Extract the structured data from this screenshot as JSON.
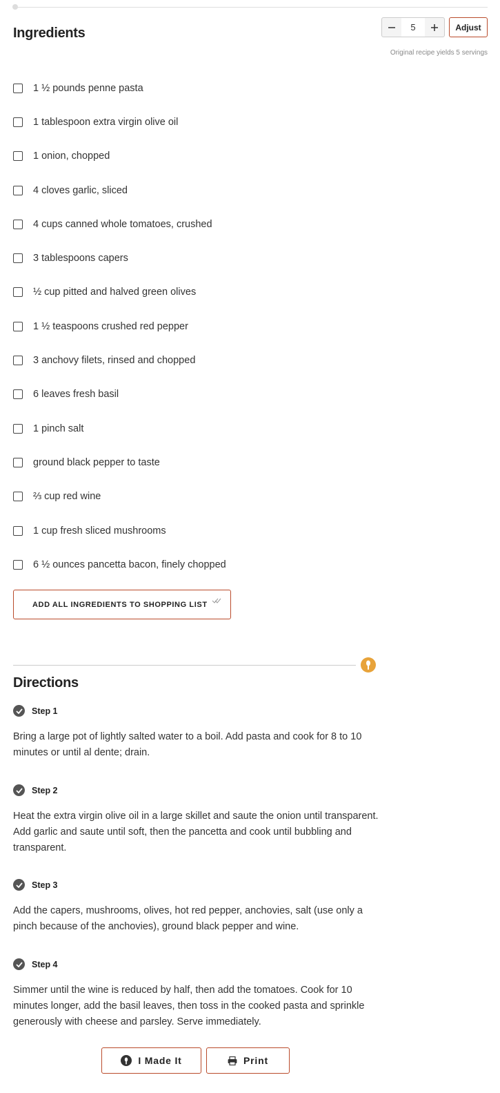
{
  "ingredients": {
    "title": "Ingredients",
    "servings": {
      "value": "5",
      "minus_icon": "minus-icon",
      "plus_icon": "plus-icon",
      "adjust_label": "Adjust",
      "note": "Original recipe yields 5 servings"
    },
    "items": [
      "1 ½ pounds penne pasta",
      "1 tablespoon extra virgin olive oil",
      "1 onion, chopped",
      "4 cloves garlic, sliced",
      "4 cups canned whole tomatoes, crushed",
      "3 tablespoons capers",
      "½ cup pitted and halved green olives",
      "1 ½ teaspoons crushed red pepper",
      "3 anchovy filets, rinsed and chopped",
      "6 leaves fresh basil",
      "1 pinch salt",
      "ground black pepper to taste",
      "⅔ cup red wine",
      "1 cup fresh sliced mushrooms",
      "6 ½ ounces pancetta bacon, finely chopped"
    ],
    "shopping_button": "ADD ALL INGREDIENTS TO SHOPPING LIST"
  },
  "directions": {
    "title": "Directions",
    "steps": [
      {
        "label": "Step 1",
        "text": "Bring a large pot of lightly salted water to a boil. Add pasta and cook for 8 to 10 minutes or until al dente; drain."
      },
      {
        "label": "Step 2",
        "text": "Heat the extra virgin olive oil in a large skillet and saute the onion until transparent. Add garlic and saute until soft, then the pancetta and cook until bubbling and transparent."
      },
      {
        "label": "Step 3",
        "text": "Add the capers, mushrooms, olives, hot red pepper, anchovies, salt (use only a pinch because of the anchovies), ground black pepper and wine."
      },
      {
        "label": "Step 4",
        "text": "Simmer until the wine is reduced by half, then add the tomatoes. Cook for 10 minutes longer, add the basil leaves, then toss in the cooked pasta and sprinkle generously with cheese and parsley. Serve immediately."
      }
    ]
  },
  "actions": {
    "made_it": "I Made It",
    "print": "Print"
  },
  "colors": {
    "accent": "#b94a2a",
    "pin": "#e8a33a",
    "check": "#555555"
  }
}
